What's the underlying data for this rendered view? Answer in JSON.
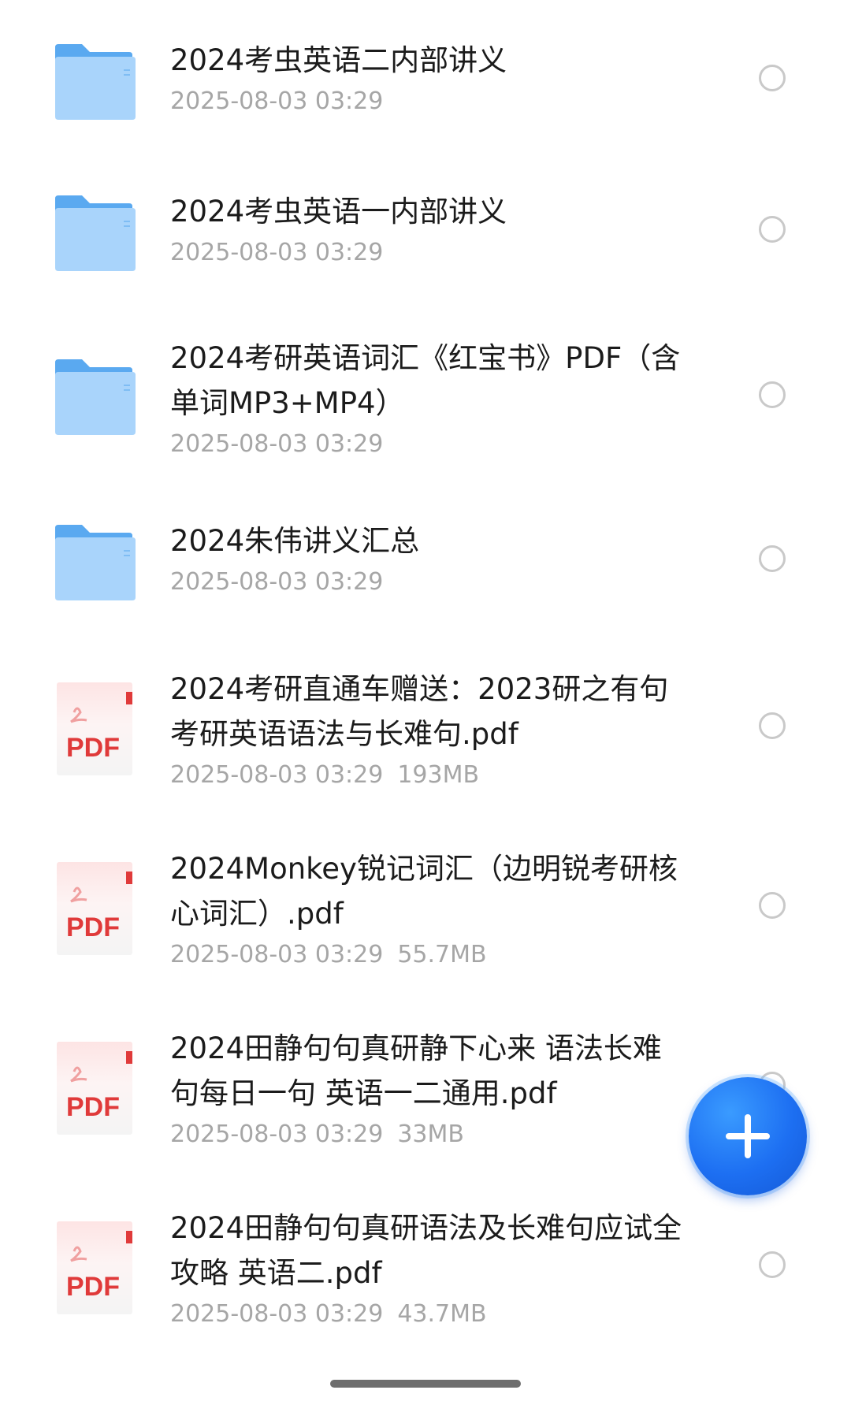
{
  "files": [
    {
      "type": "folder",
      "name": "2024考虫英语二内部讲义",
      "date": "2025-08-03 03:29",
      "size": ""
    },
    {
      "type": "folder",
      "name": "2024考虫英语一内部讲义",
      "date": "2025-08-03 03:29",
      "size": ""
    },
    {
      "type": "folder",
      "name": "2024考研英语词汇《红宝书》PDF（含单词MP3+MP4）",
      "date": "2025-08-03 03:29",
      "size": ""
    },
    {
      "type": "folder",
      "name": "2024朱伟讲义汇总",
      "date": "2025-08-03 03:29",
      "size": ""
    },
    {
      "type": "pdf",
      "icon_label": "PDF",
      "name": "2024考研直通车赠送：2023研之有句 考研英语语法与长难句.pdf",
      "date": "2025-08-03 03:29",
      "size": "193MB"
    },
    {
      "type": "pdf",
      "icon_label": "PDF",
      "name": "2024Monkey锐记词汇（边明锐考研核心词汇）.pdf",
      "date": "2025-08-03 03:29",
      "size": "55.7MB"
    },
    {
      "type": "pdf",
      "icon_label": "PDF",
      "name": "2024田静句句真研静下心来 语法长难句每日一句 英语一二通用.pdf",
      "date": "2025-08-03 03:29",
      "size": "33MB"
    },
    {
      "type": "pdf",
      "icon_label": "PDF",
      "name": "2024田静句句真研语法及长难句应试全攻略  英语二.pdf",
      "date": "2025-08-03 03:29",
      "size": "43.7MB"
    }
  ],
  "fab": {
    "icon": "plus-icon"
  },
  "colors": {
    "folder_back": "#5aa9f0",
    "folder_front": "#a9d4fb",
    "pdf_red": "#e03a3a",
    "fab_blue": "#1d6ff2",
    "title_text": "#1b1b1b",
    "meta_text": "#a6a6a6"
  }
}
